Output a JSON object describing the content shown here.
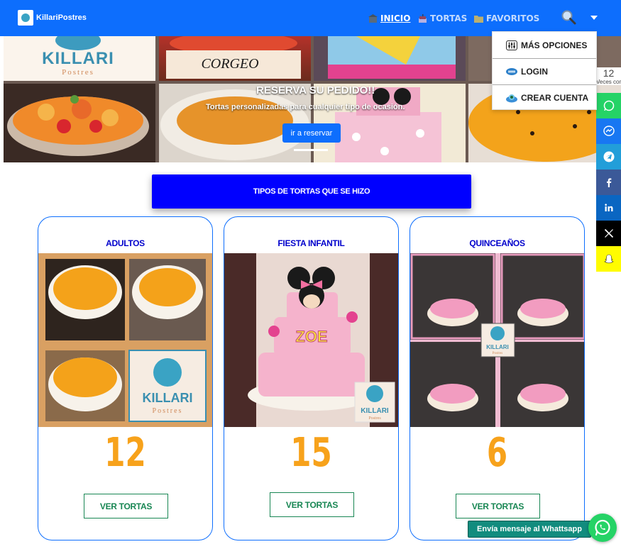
{
  "navbar": {
    "brand": "KillariPostres",
    "items": [
      {
        "label": "INICIO",
        "icon": "home-icon"
      },
      {
        "label": "TORTAS",
        "icon": "cake-icon"
      },
      {
        "label": "FAVORITOS",
        "icon": "folder-icon"
      }
    ],
    "search_icon": "search-icon",
    "dropdown_icon": "chevron-down-icon"
  },
  "dropdown": {
    "items": [
      {
        "label": "MÁS OPCIONES",
        "icon": "sliders-icon"
      },
      {
        "label": "LOGIN",
        "icon": "login-icon"
      },
      {
        "label": "CREAR CUENTA",
        "icon": "globe-icon"
      }
    ]
  },
  "hero": {
    "logo_text": "KILLARI",
    "logo_sub": "Postres",
    "cake_text": "CORGEO",
    "title": "RESERVA SU PEDIDO!!",
    "subtitle": "Tortas personalizadas para cualquier tipo de ocasión.",
    "button": "ir a reservar"
  },
  "share": {
    "count": "12",
    "count_label": "Veces compart",
    "buttons": [
      {
        "icon": "whatsapp-icon",
        "color": "#25d366"
      },
      {
        "icon": "messenger-icon",
        "color": "#1877f2"
      },
      {
        "icon": "telegram-icon",
        "color": "#229ed9"
      },
      {
        "icon": "facebook-icon",
        "color": "#3b5998"
      },
      {
        "icon": "linkedin-icon",
        "color": "#0a66c2"
      },
      {
        "icon": "x-icon",
        "color": "#000000"
      },
      {
        "icon": "snapchat-icon",
        "color": "#fffc00"
      }
    ]
  },
  "section": {
    "title": "TIPOS DE TORTAS QUE SE HIZO"
  },
  "cards": [
    {
      "title": "ADULTOS",
      "count": "12",
      "button": "VER TORTAS"
    },
    {
      "title": "FIESTA INFANTIL",
      "count": "15",
      "button": "VER TORTAS",
      "logo_text": "KILLARI",
      "logo_sub": "Postres",
      "cake_text": "ZOE"
    },
    {
      "title": "QUINCEAÑOS",
      "count": "6",
      "button": "VER TORTAS",
      "logo_text": "KILLARI",
      "logo_sub": "Postres"
    }
  ],
  "adultos_logo": {
    "text": "KILLARI",
    "sub": "Postres"
  },
  "whatsapp": {
    "label": "Envía mensaje al Whattsapp"
  },
  "colors": {
    "navbar": "#0d6efd",
    "section": "#0000ff",
    "accent_number": "#f7a21b",
    "button_green": "#198754"
  }
}
